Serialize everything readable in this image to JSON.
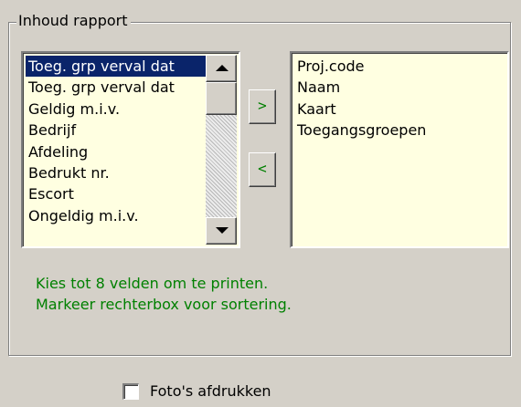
{
  "group": {
    "title": "Inhoud rapport"
  },
  "left_list": {
    "items": [
      "Toeg. grp verval dat",
      "Toeg. grp verval dat",
      "Geldig m.i.v.",
      "Bedrijf",
      "Afdeling",
      "Bedrukt nr.",
      "Escort",
      "Ongeldig m.i.v."
    ],
    "selected_index": 0
  },
  "right_list": {
    "items": [
      "Proj.code",
      "Naam",
      "Kaart",
      "Toegangsgroepen"
    ]
  },
  "buttons": {
    "move_right": ">",
    "move_left": "<"
  },
  "hints": {
    "line1": "Kies tot 8 velden om te printen.",
    "line2": "Markeer rechterbox voor sortering."
  },
  "photo_checkbox": {
    "label": "Foto's afdrukken",
    "checked": false
  },
  "colors": {
    "list_bg": "#ffffe1",
    "selection": "#0a246a",
    "hint_text": "#008000",
    "window_bg": "#d4d0c8"
  }
}
